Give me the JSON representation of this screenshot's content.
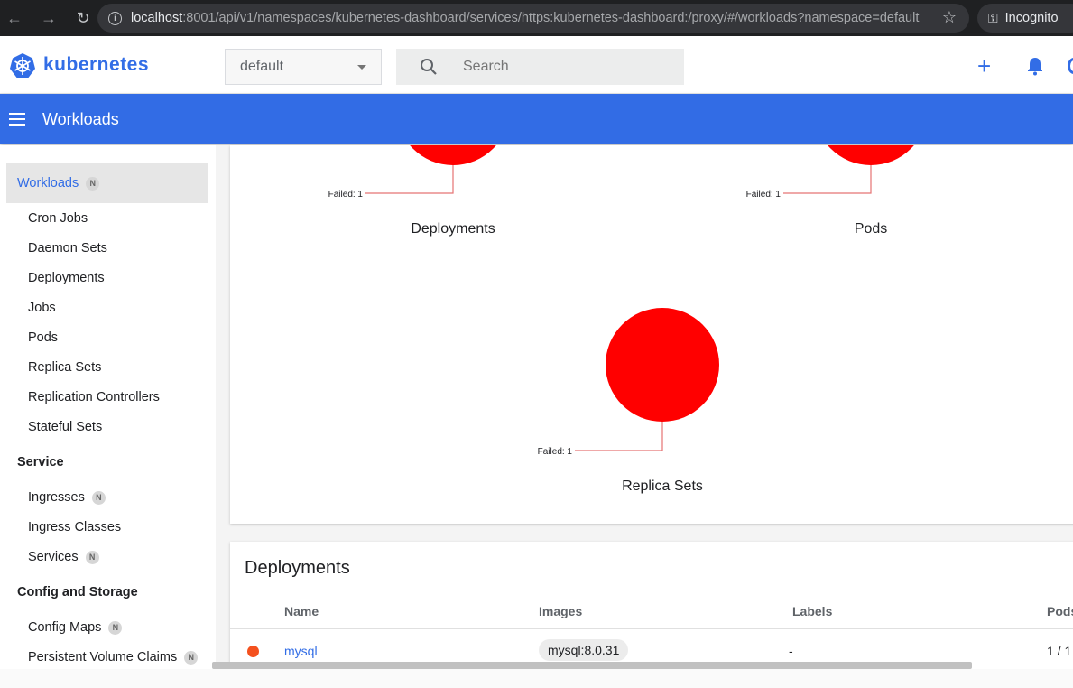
{
  "browser": {
    "url_host": "localhost",
    "url_path": ":8001/api/v1/namespaces/kubernetes-dashboard/services/https:kubernetes-dashboard:/proxy/#/workloads?namespace=default",
    "incognito_label": "Incognito",
    "icons": [
      "back-icon",
      "forward-icon",
      "reload-icon",
      "info-icon",
      "star-icon",
      "incognito-icon"
    ]
  },
  "header": {
    "brand": "kubernetes",
    "namespace": "default",
    "search_placeholder": "Search",
    "plus_label": "+"
  },
  "toolbar": {
    "title": "Workloads"
  },
  "sidebar": {
    "active": "Workloads",
    "active_badge": "N",
    "workloads_items": [
      "Cron Jobs",
      "Daemon Sets",
      "Deployments",
      "Jobs",
      "Pods",
      "Replica Sets",
      "Replication Controllers",
      "Stateful Sets"
    ],
    "service_heading": "Service",
    "service_items": [
      {
        "label": "Ingresses",
        "badge": "N"
      },
      {
        "label": "Ingress Classes",
        "badge": ""
      },
      {
        "label": "Services",
        "badge": "N"
      }
    ],
    "config_heading": "Config and Storage",
    "config_items": [
      {
        "label": "Config Maps",
        "badge": "N"
      },
      {
        "label": "Persistent Volume Claims",
        "badge": "N"
      }
    ]
  },
  "charts": {
    "deployments": {
      "title": "Deployments",
      "legend": "Failed: 1"
    },
    "pods": {
      "title": "Pods",
      "legend": "Failed: 1"
    },
    "replica_sets": {
      "title": "Replica Sets",
      "legend": "Failed: 1"
    },
    "failed_color": "#ff0000"
  },
  "deployments_table": {
    "title": "Deployments",
    "columns": [
      "Name",
      "Images",
      "Labels",
      "Pods"
    ],
    "rows": [
      {
        "name": "mysql",
        "image": "mysql:8.0.31",
        "labels": "-",
        "pods": "1 / 1"
      }
    ]
  }
}
